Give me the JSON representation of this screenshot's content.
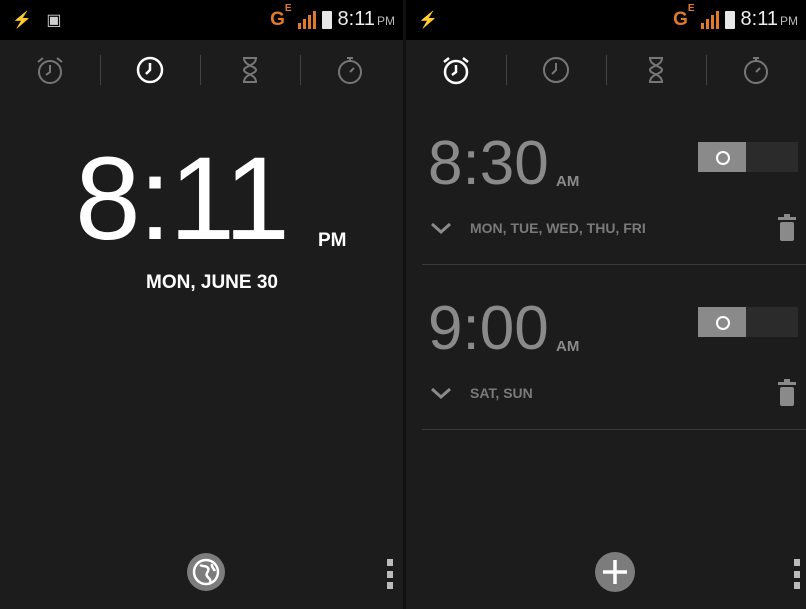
{
  "left_status": {
    "icons": [
      "usb-icon",
      "image-icon"
    ],
    "network": "G",
    "network_sup": "E",
    "time": "8:11",
    "ampm": "PM"
  },
  "right_status": {
    "icons": [
      "usb-icon"
    ],
    "network": "G",
    "network_sup": "E",
    "time": "8:11",
    "ampm": "PM"
  },
  "tabs": [
    "alarm-tab",
    "clock-tab",
    "timer-tab",
    "stopwatch-tab"
  ],
  "clock": {
    "time": "8:11",
    "ampm": "PM",
    "date": "MON, JUNE 30"
  },
  "alarms": [
    {
      "time": "8:30",
      "ampm": "AM",
      "days": "MON, TUE, WED, THU, FRI",
      "enabled": false
    },
    {
      "time": "9:00",
      "ampm": "AM",
      "days": "SAT, SUN",
      "enabled": false
    }
  ],
  "colors": {
    "accent": "#e07a2a",
    "bg": "#1c1c1c",
    "muted": "#8a8a8a"
  }
}
